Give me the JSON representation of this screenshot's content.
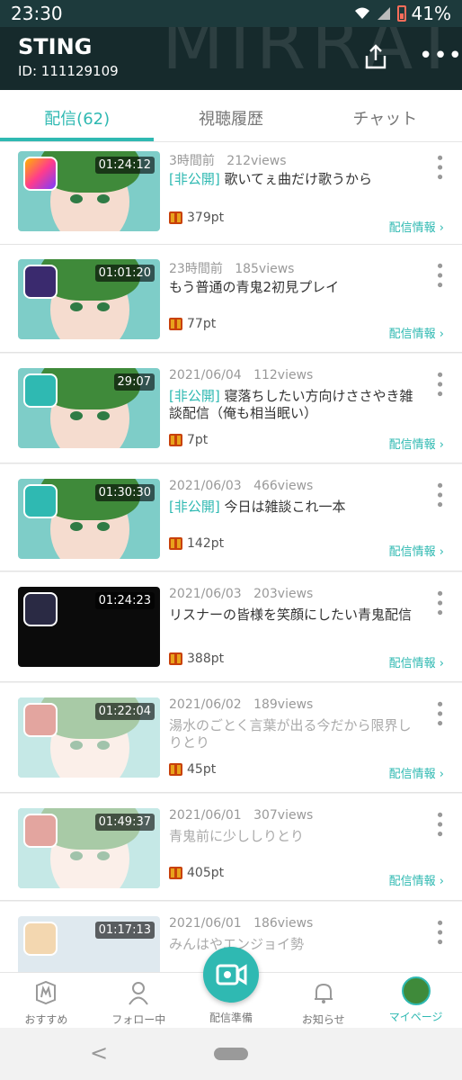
{
  "status_bar": {
    "time": "23:30",
    "battery": "41%"
  },
  "header": {
    "name": "STING",
    "id": "ID: 111129109"
  },
  "tabs": [
    {
      "label": "配信(62)"
    },
    {
      "label": "視聴履歴"
    },
    {
      "label": "チャット"
    }
  ],
  "items": [
    {
      "meta_time": "3時間前",
      "meta_views": "212views",
      "tag": "[非公開]",
      "title": "歌いてぇ曲だけ歌うから",
      "duration": "01:24:12",
      "points": "379pt",
      "info": "配信情報 ›"
    },
    {
      "meta_time": "23時間前",
      "meta_views": "185views",
      "tag": "",
      "title": "もう普通の青鬼2初見プレイ",
      "duration": "01:01:20",
      "points": "77pt",
      "info": "配信情報 ›"
    },
    {
      "meta_time": "2021/06/04",
      "meta_views": "112views",
      "tag": "[非公開]",
      "title": "寝落ちしたい方向けささやき雑談配信（俺も相当眠い）",
      "duration": "29:07",
      "points": "7pt",
      "info": "配信情報 ›"
    },
    {
      "meta_time": "2021/06/03",
      "meta_views": "466views",
      "tag": "[非公開]",
      "title": "今日は雑談これ一本",
      "duration": "01:30:30",
      "points": "142pt",
      "info": "配信情報 ›"
    },
    {
      "meta_time": "2021/06/03",
      "meta_views": "203views",
      "tag": "",
      "title": "リスナーの皆様を笑顔にしたい青鬼配信",
      "duration": "01:24:23",
      "points": "388pt",
      "info": "配信情報 ›"
    },
    {
      "meta_time": "2021/06/02",
      "meta_views": "189views",
      "tag": "",
      "title": "湯水のごとく言葉が出る今だから限界しりとり",
      "duration": "01:22:04",
      "points": "45pt",
      "info": "配信情報 ›"
    },
    {
      "meta_time": "2021/06/01",
      "meta_views": "307views",
      "tag": "",
      "title": "青鬼前に少ししりとり",
      "duration": "01:49:37",
      "points": "405pt",
      "info": "配信情報 ›"
    },
    {
      "meta_time": "2021/06/01",
      "meta_views": "186views",
      "tag": "",
      "title": "みんはやエンジョイ勢",
      "duration": "01:17:13",
      "points": "",
      "info": ""
    }
  ],
  "bottom_nav": [
    {
      "label": "おすすめ"
    },
    {
      "label": "フォロー中"
    },
    {
      "label": "配信準備"
    },
    {
      "label": "お知らせ"
    },
    {
      "label": "マイページ"
    }
  ],
  "colors": {
    "accent": "#2fb9b2",
    "header": "#162a2c"
  }
}
